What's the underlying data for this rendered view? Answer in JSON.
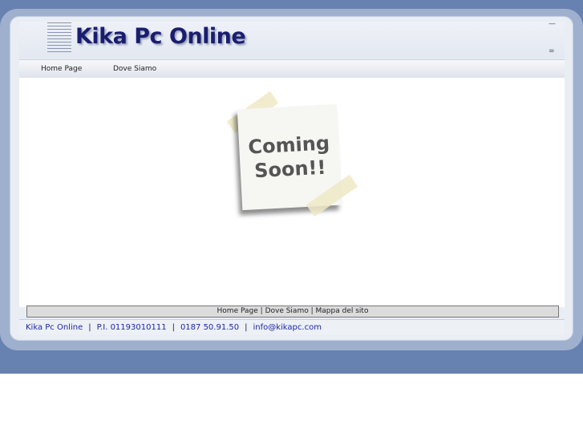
{
  "header": {
    "title": "Kika Pc Online",
    "corner_top": "—",
    "corner_bottom": "="
  },
  "nav": {
    "items": [
      {
        "label": "Home Page"
      },
      {
        "label": "Dove Siamo"
      }
    ]
  },
  "main": {
    "note_line1": "Coming",
    "note_line2": "Soon!!"
  },
  "footer": {
    "links": [
      {
        "label": "Home Page"
      },
      {
        "label": "Dove Siamo"
      },
      {
        "label": "Mappa del sito"
      }
    ],
    "link_separator": "|",
    "info": [
      "Kika Pc Online",
      "P.I. 01193010111",
      "0187 50.91.50",
      "info@kikapc.com"
    ],
    "info_separator": "|"
  },
  "colors": {
    "outer_band": "#6781b1",
    "frame": "#9fb0cf",
    "title": "#1a1d6e",
    "footer_text": "#1c28a6"
  }
}
